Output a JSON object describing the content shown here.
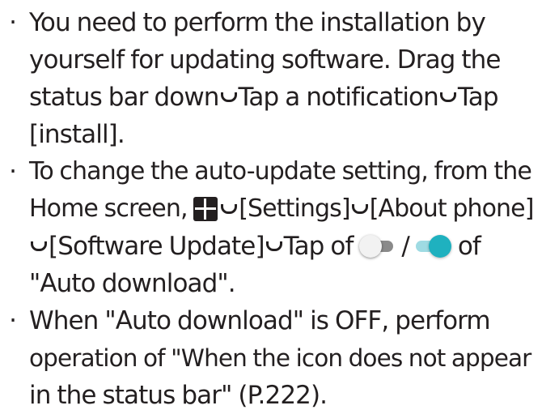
{
  "bullet_glyph": "·",
  "arrow_icon": "arrow-icon",
  "apps_icon": "apps-grid-icon",
  "toggle_colors": {
    "off_track": "#8a8a8a",
    "off_knob": "#f2f2f2",
    "on_track": "#9fdbe3",
    "on_knob": "#1fb1bf"
  },
  "text_color": "#231f20",
  "bullets": [
    {
      "l1": "You need to perform the installation by",
      "l2": "yourself for updating software. Drag the",
      "l3a": "status bar down",
      "l3b": "Tap a notification",
      "l3c": "Tap",
      "l4": "[install]."
    },
    {
      "l1": "To change the auto-update setting, from the",
      "l2a": "Home screen, ",
      "l2b": "[Settings]",
      "l2c": "[About phone]",
      "l3a": "[Software Update]",
      "l3b": "Tap of ",
      "l3c": " / ",
      "l3d": " of",
      "l4": "\"Auto download\"."
    },
    {
      "l1": "When \"Auto download\" is OFF, perform",
      "l2": "operation of \"When the icon does not appear",
      "l3": "in the status bar\" (P.222)."
    }
  ]
}
